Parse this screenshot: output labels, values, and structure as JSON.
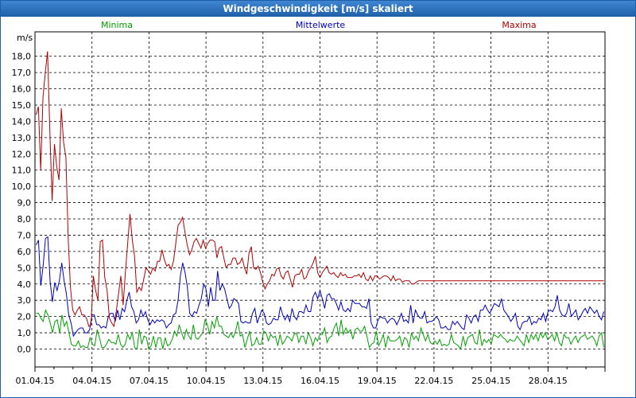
{
  "window": {
    "title": "Windgeschwindigkeit [m/s] skaliert"
  },
  "chart_data": {
    "type": "line",
    "title": "Windgeschwindigkeit [m/s] skaliert",
    "ylabel": "m/s",
    "ylim": [
      -1.1,
      19.5
    ],
    "yticks": [
      "0,0",
      "1,0",
      "2,0",
      "3,0",
      "4,0",
      "5,0",
      "6,0",
      "7,0",
      "8,0",
      "9,0",
      "10,0",
      "11,0",
      "12,0",
      "13,0",
      "14,0",
      "15,0",
      "16,0",
      "17,0",
      "18,0"
    ],
    "xticks": [
      "01.04.15",
      "04.04.15",
      "07.04.15",
      "10.04.15",
      "13.04.15",
      "16.04.15",
      "19.04.15",
      "22.04.15",
      "25.04.15",
      "28.04.15"
    ],
    "grid": true,
    "legend_position": "top",
    "series": [
      {
        "name": "Minima",
        "color": "#00a000",
        "values": [
          2.2,
          2.2,
          1.9,
          1.7,
          2.4,
          2.1,
          1.6,
          1.0,
          1.7,
          1.8,
          1.0,
          2.1,
          1.4,
          1.7,
          1.0,
          0.3,
          0.2,
          0.2,
          0.5,
          0.1,
          0.2,
          0.1,
          0.1,
          0.7,
          0.3,
          0.2,
          1.2,
          0.7,
          0.1,
          0.1,
          0.3,
          0.6,
          0.4,
          0.4,
          0.3,
          0.9,
          0.3,
          0.1,
          0.3,
          0.9,
          0.6,
          1.0,
          0.1,
          0.0,
          1.2,
          0.3,
          0.8,
          0.7,
          0.0,
          0.2,
          0.8,
          0.1,
          0.7,
          0.7,
          0.0,
          0.7,
          0.2,
          0.3,
          0.6,
          1.1,
          0.8,
          1.5,
          1.0,
          0.6,
          1.2,
          0.8,
          0.6,
          1.5,
          0.7,
          0.6,
          0.8,
          1.0,
          1.8,
          1.5,
          0.9,
          1.7,
          1.3,
          2.0,
          1.4,
          1.4,
          0.9,
          0.8,
          0.7,
          1.0,
          0.7,
          1.1,
          1.7,
          0.8,
          0.9,
          0.1,
          0.6,
          1.1,
          0.2,
          0.3,
          0.7,
          0.3,
          0.3,
          1.1,
          1.0,
          0.5,
          0.9,
          0.7,
          0.8,
          0.2,
          0.9,
          0.3,
          0.5,
          0.8,
          0.7,
          0.5,
          0.9,
          1.0,
          0.4,
          0.8,
          0.8,
          0.3,
          1.0,
          0.7,
          0.2,
          0.7,
          0.5,
          0.9,
          0.9,
          1.3,
          0.4,
          0.7,
          0.8,
          1.3,
          1.6,
          0.8,
          1.8,
          0.9,
          1.3,
          1.0,
          1.2,
          0.6,
          1.2,
          1.3,
          1.1,
          1.1,
          1.4,
          0.8,
          0.1,
          0.3,
          0.4,
          1.1,
          0.2,
          0.5,
          0.9,
          0.1,
          0.8,
          0.5,
          0.5,
          0.5,
          0.6,
          0.8,
          0.2,
          0.7,
          0.6,
          0.1,
          1.0,
          0.6,
          0.8,
          0.5,
          1.3,
          0.9,
          0.5,
          0.9,
          0.4,
          0.3,
          0.5,
          0.3,
          0.6,
          0.2,
          0.3,
          0.2,
          0.3,
          0.9,
          0.4,
          0.3,
          0.2,
          0.0,
          0.8,
          0.2,
          0.7,
          0.8,
          0.9,
          0.4,
          0.3,
          1.2,
          0.2,
          0.6,
          0.4,
          0.6,
          0.3,
          0.9,
          0.8,
          0.7,
          0.9,
          0.7,
          0.6,
          0.4,
          0.6,
          0.5,
          0.5,
          0.8,
          0.6,
          0.4,
          0.2,
          0.9,
          0.4,
          0.9,
          0.6,
          0.9,
          0.5,
          1.0,
          0.7,
          1.0,
          0.6,
          0.7,
          0.9,
          0.5,
          1.0,
          0.4,
          0.2,
          0.9,
          0.7,
          0.7,
          0.3,
          0.6,
          0.8,
          0.4,
          0.7,
          0.8,
          0.9,
          0.6,
          0.7,
          0.8,
          0.6,
          0.2,
          0.8,
          1.0,
          0.1
        ]
      },
      {
        "name": "Mittelwerte",
        "color": "#0000c0",
        "values": [
          6.4,
          6.7,
          3.9,
          5.1,
          6.8,
          6.9,
          4.2,
          2.9,
          4.1,
          3.6,
          4.2,
          5.3,
          4.2,
          3.4,
          2.1,
          1.6,
          0.8,
          1.0,
          1.2,
          1.3,
          1.3,
          1.0,
          1.0,
          1.2,
          2.1,
          2.1,
          1.5,
          1.5,
          1.3,
          1.4,
          1.3,
          2.0,
          2.2,
          2.2,
          1.7,
          2.4,
          1.8,
          2.5,
          2.3,
          3.0,
          3.5,
          2.6,
          2.3,
          1.6,
          1.8,
          2.4,
          2.0,
          2.3,
          1.8,
          1.5,
          1.8,
          1.6,
          1.8,
          1.7,
          1.8,
          1.7,
          1.3,
          1.5,
          1.6,
          2.1,
          2.2,
          3.0,
          4.5,
          5.3,
          4.7,
          3.8,
          2.2,
          2.0,
          2.3,
          2.2,
          2.7,
          3.1,
          4.0,
          3.7,
          2.6,
          3.8,
          3.0,
          3.0,
          4.8,
          3.6,
          4.0,
          3.7,
          3.1,
          2.5,
          2.7,
          3.1,
          3.0,
          2.8,
          1.7,
          1.6,
          1.7,
          1.6,
          1.6,
          2.2,
          2.5,
          1.6,
          2.0,
          2.4,
          2.2,
          1.6,
          1.5,
          1.6,
          1.9,
          1.8,
          1.8,
          2.6,
          2.1,
          1.8,
          2.1,
          1.7,
          2.5,
          2.0,
          1.8,
          2.3,
          2.3,
          2.2,
          2.7,
          2.3,
          2.3,
          3.2,
          3.5,
          3.1,
          3.6,
          3.1,
          2.5,
          3.3,
          3.4,
          3.1,
          3.1,
          2.8,
          2.4,
          2.9,
          2.4,
          2.3,
          2.5,
          2.3,
          3.0,
          2.8,
          2.8,
          2.8,
          2.6,
          2.6,
          2.5,
          3.1,
          1.6,
          1.3,
          1.3,
          1.8,
          2.0,
          1.9,
          1.9,
          1.6,
          1.8,
          1.9,
          1.8,
          1.5,
          1.8,
          2.2,
          1.7,
          1.8,
          1.6,
          2.7,
          1.6,
          2.4,
          2.1,
          1.9,
          1.9,
          2.3,
          1.6,
          1.7,
          1.7,
          1.8,
          2.0,
          1.8,
          1.3,
          1.3,
          1.4,
          1.2,
          1.2,
          1.7,
          1.5,
          1.7,
          1.5,
          1.3,
          1.2,
          2.1,
          1.9,
          1.6,
          2.0,
          2.1,
          1.7,
          2.4,
          2.4,
          2.7,
          2.4,
          2.2,
          2.5,
          2.8,
          2.7,
          2.6,
          3.1,
          2.4,
          2.2,
          2.0,
          1.7,
          1.9,
          2.2,
          1.4,
          1.2,
          1.6,
          1.7,
          1.7,
          2.0,
          1.5,
          1.7,
          1.6,
          1.9,
          1.8,
          2.2,
          1.7,
          2.3,
          2.4,
          2.3,
          2.6,
          3.3,
          2.4,
          2.1,
          2.0,
          2.2,
          2.8,
          2.0,
          2.2,
          2.4,
          1.8,
          2.0,
          2.3,
          2.5,
          2.2,
          2.6,
          2.4,
          2.2,
          2.4,
          2.0,
          1.8,
          2.3
        ]
      },
      {
        "name": "Maxima",
        "color": "#b00000",
        "values": [
          14.4,
          14.9,
          11.0,
          15.5,
          17.0,
          18.3,
          13.4,
          9.1,
          12.6,
          11.2,
          10.4,
          14.8,
          12.7,
          11.8,
          6.8,
          3.8,
          2.4,
          2.1,
          2.4,
          2.6,
          2.1,
          2.1,
          1.9,
          1.4,
          1.5,
          4.5,
          3.6,
          3.0,
          6.6,
          6.7,
          4.4,
          3.6,
          1.9,
          1.6,
          1.4,
          2.3,
          3.4,
          4.5,
          2.7,
          4.7,
          6.5,
          8.3,
          6.7,
          5.7,
          3.5,
          3.8,
          3.6,
          4.3,
          5.0,
          4.8,
          4.6,
          5.0,
          4.8,
          5.4,
          5.4,
          6.1,
          5.5,
          5.1,
          5.2,
          4.9,
          5.4,
          6.5,
          7.6,
          7.8,
          8.1,
          7.2,
          6.4,
          5.8,
          6.1,
          6.6,
          6.8,
          6.5,
          6.2,
          6.7,
          6.2,
          6.5,
          6.7,
          6.7,
          6.6,
          5.6,
          6.2,
          6.3,
          5.6,
          5.0,
          5.2,
          5.2,
          5.6,
          5.6,
          5.2,
          5.3,
          5.6,
          5.0,
          4.6,
          5.9,
          6.3,
          5.0,
          4.9,
          5.1,
          4.7,
          4.1,
          3.7,
          4.0,
          4.2,
          4.6,
          4.5,
          4.9,
          5.0,
          4.5,
          4.3,
          4.7,
          4.8,
          4.3,
          3.8,
          4.5,
          4.6,
          4.6,
          4.9,
          4.3,
          4.4,
          4.8,
          5.0,
          5.3,
          5.7,
          4.7,
          4.4,
          4.7,
          4.9,
          5.1,
          4.7,
          4.6,
          4.7,
          4.5,
          4.4,
          4.7,
          4.5,
          4.6,
          4.4,
          4.4,
          4.4,
          4.5,
          4.5,
          4.6,
          4.4,
          4.7,
          4.3,
          4.2,
          4.5,
          4.2,
          4.5,
          4.5,
          4.3,
          4.4,
          4.5,
          4.5,
          4.4,
          4.2,
          4.5,
          4.2,
          4.3,
          4.3,
          4.1,
          4.2,
          4.2,
          4.2,
          4.0,
          4.0,
          4.1,
          4.2,
          4.2,
          4.2,
          4.2,
          4.2,
          4.2,
          4.2,
          4.2,
          4.2,
          4.2,
          4.2,
          4.2,
          4.2,
          4.2,
          4.2,
          4.2,
          4.2,
          4.2,
          4.2,
          4.2,
          4.2,
          4.2,
          4.2,
          4.2,
          4.2,
          4.2,
          4.2,
          4.2,
          4.2,
          4.2,
          4.2,
          4.2,
          4.2,
          4.2,
          4.2,
          4.2,
          4.2,
          4.2,
          4.2,
          4.2,
          4.2,
          4.2,
          4.2,
          4.2,
          4.2,
          4.2,
          4.2,
          4.2,
          4.2,
          4.2,
          4.2,
          4.2,
          4.2,
          4.2,
          4.2,
          4.2,
          4.2,
          4.2,
          4.2,
          4.2,
          4.2,
          4.2,
          4.2,
          4.2,
          4.2,
          4.2,
          4.2,
          4.2,
          4.2,
          4.2,
          4.2,
          4.2,
          4.2,
          4.2,
          4.2,
          4.2,
          4.2,
          4.2,
          4.2,
          4.2,
          4.2,
          4.2
        ]
      }
    ]
  }
}
